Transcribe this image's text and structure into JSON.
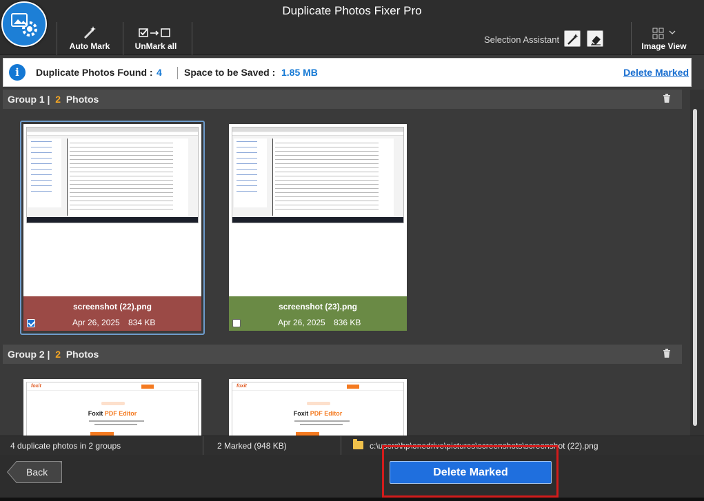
{
  "window": {
    "title": "Duplicate Photos Fixer Pro"
  },
  "toolbar": {
    "auto_mark": "Auto Mark",
    "unmark_all": "UnMark all",
    "selection_assistant": "Selection Assistant",
    "image_view": "Image View"
  },
  "summary": {
    "found_label": "Duplicate Photos Found :",
    "found_value": "4",
    "space_label": "Space to be Saved :",
    "space_value": "1.85 MB",
    "delete_link": "Delete Marked"
  },
  "groups": [
    {
      "label": "Group 1 |",
      "count": "2",
      "count_label": "Photos",
      "photos": [
        {
          "name": "screenshot (22).png",
          "date": "Apr 26, 2025",
          "size": "834 KB",
          "checked": true,
          "color": "#9b4a46"
        },
        {
          "name": "screenshot (23).png",
          "date": "Apr 26, 2025",
          "size": "836 KB",
          "checked": false,
          "color": "#6a8a45"
        }
      ]
    },
    {
      "label": "Group 2 |",
      "count": "2",
      "count_label": "Photos",
      "photos": [
        {
          "heading_a": "Foxit",
          "heading_b": "PDF Editor"
        },
        {
          "heading_a": "Foxit",
          "heading_b": "PDF Editor"
        }
      ]
    }
  ],
  "status": {
    "summary": "4 duplicate photos in 2 groups",
    "marked": "2 Marked (948 KB)",
    "path": "c:\\users\\hp\\onedrive\\pictures\\screenshots\\screenshot (22).png"
  },
  "footer": {
    "back": "Back",
    "delete_marked": "Delete Marked"
  },
  "colors": {
    "accent": "#1f6fde",
    "count": "#f5a623",
    "marked_card": "#9b4a46",
    "kept_card": "#6a8a45"
  }
}
